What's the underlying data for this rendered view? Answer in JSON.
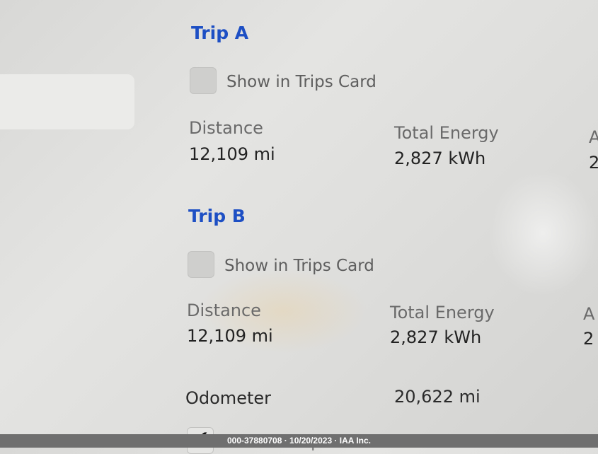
{
  "trip_a": {
    "title": "Trip A",
    "show_label": "Show in Trips Card",
    "distance_label": "Distance",
    "distance_value": "12,109 mi",
    "energy_label": "Total Energy",
    "energy_value": "2,827 kWh",
    "third_label_partial": "A",
    "third_value_partial": "2"
  },
  "trip_b": {
    "title": "Trip B",
    "show_label": "Show in Trips Card",
    "distance_label": "Distance",
    "distance_value": "12,109 mi",
    "energy_label": "Total Energy",
    "energy_value": "2,827 kWh",
    "third_label_partial": "A",
    "third_value_partial": "2"
  },
  "odometer": {
    "label": "Odometer",
    "value": "20,622 mi"
  },
  "bottom_row": {
    "label_partial": "Show in Trips Card"
  },
  "watermark": "000-37880708 · 10/20/2023 · IAA Inc.",
  "colors": {
    "heading": "#1d4fc4",
    "background": "#dfdfdd"
  },
  "icons": {
    "checkbox": "checkbox-icon",
    "check": "check-icon"
  }
}
